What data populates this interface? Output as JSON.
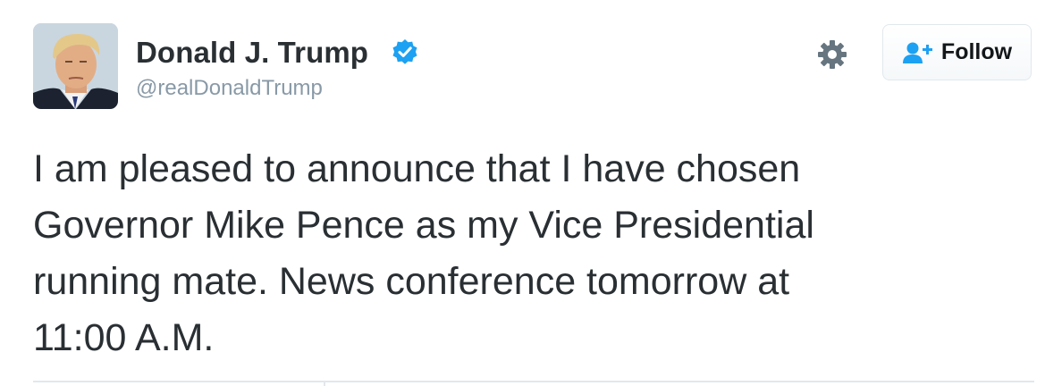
{
  "user": {
    "display_name": "Donald J. Trump",
    "handle": "@realDonaldTrump",
    "verified": true,
    "avatar_icon": "profile-photo"
  },
  "actions": {
    "settings_icon": "gear-icon",
    "follow_label": "Follow",
    "follow_icon": "add-user-icon"
  },
  "tweet": {
    "text": "I am pleased to announce that I have chosen\nGovernor Mike Pence as my Vice Presidential\nrunning mate. News conference tomorrow at\n11:00 A.M."
  },
  "colors": {
    "text": "#292f33",
    "handle": "#8899a6",
    "verified_badge": "#1da1f2",
    "follow_icon": "#1da1f2",
    "gear": "#66757f",
    "border": "#e1e8ed"
  }
}
